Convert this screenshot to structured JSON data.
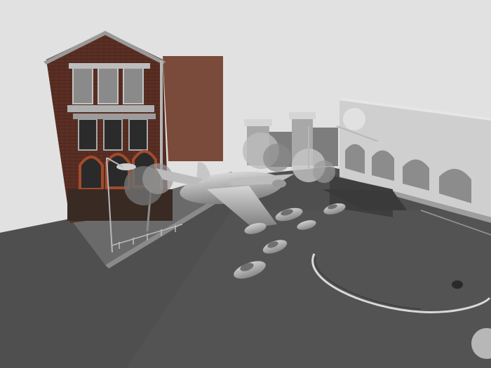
{
  "scene": {
    "colors": {
      "sky": "#e1e1e1",
      "ground": "#4f4f4f",
      "plaza": "#5a5a5a",
      "brick": "#5a2f24",
      "brick_dark": "#3e1f18",
      "stone": "#b9b9b9",
      "arcade": "#cfcfcf",
      "aircraft": "#a9a9a9",
      "car": "#a3a3a3",
      "foliage": "#c9c9c9"
    },
    "objects": [
      "brick-building",
      "arched-facade",
      "gate-pillars",
      "airplane-sculpture",
      "cars",
      "trees",
      "street-lamps",
      "circular-plaza-marking"
    ]
  }
}
